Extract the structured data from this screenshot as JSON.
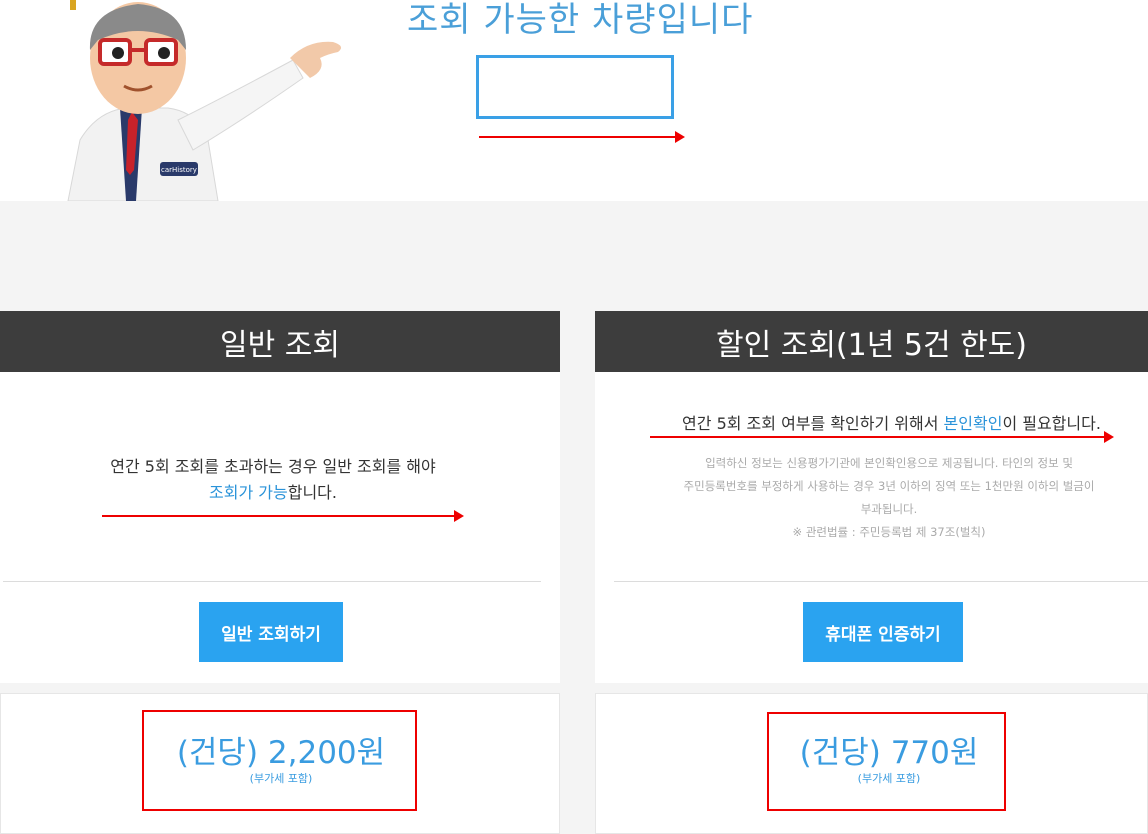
{
  "hero": {
    "headline": "조회 가능한 차량입니다",
    "badge_text": "carHistory"
  },
  "general": {
    "title": "일반 조회",
    "desc_line1": "연간 5회 조회를 초과하는 경우 일반 조회를 해야",
    "desc_link": "조회가 가능",
    "desc_tail": "합니다.",
    "button": "일반 조회하기",
    "price": "(건당) 2,200원",
    "vat": "(부가세 포함)"
  },
  "discount": {
    "title": "할인 조회(1년 5건 한도)",
    "desc_pre": "연간 5회 조회 여부를 확인하기 위해서 ",
    "desc_link": "본인확인",
    "desc_post": "이 필요합니다.",
    "fine_line1": "입력하신 정보는 신용평가기관에 본인확인용으로 제공됩니다. 타인의 정보 및",
    "fine_line2": "주민등록번호를 부정하게 사용하는 경우 3년 이하의 징역 또는 1천만원 이하의 벌금이",
    "fine_line3": "부과됩니다.",
    "fine_line4": "※ 관련법률 : 주민등록법 제 37조(벌칙)",
    "button": "휴대폰 인증하기",
    "price": "(건당) 770원",
    "vat": "(부가세 포함)"
  },
  "colors": {
    "accent": "#2aa3f0",
    "header_bg": "#3d3d3d",
    "annotation": "#ee0000"
  }
}
